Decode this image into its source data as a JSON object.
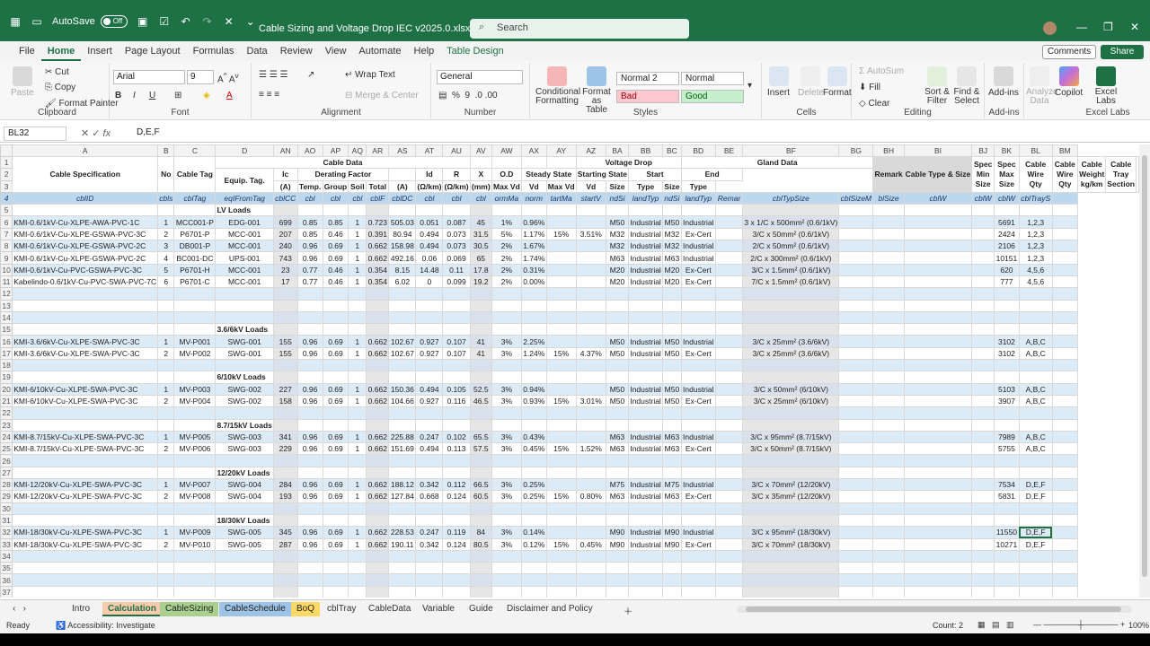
{
  "window": {
    "autosave_label": "AutoSave",
    "autosave_state": "Off",
    "filename": "Cable Sizing and Voltage Drop IEC v2025.0.xlsx",
    "search_placeholder": "Search"
  },
  "tabs": [
    "File",
    "Home",
    "Insert",
    "Page Layout",
    "Formulas",
    "Data",
    "Review",
    "View",
    "Automate",
    "Help",
    "Table Design"
  ],
  "buttons": {
    "comments": "Comments",
    "share": "Share"
  },
  "ribbon": {
    "clipboard": {
      "label": "Clipboard",
      "paste": "Paste",
      "cut": "Cut",
      "copy": "Copy",
      "format_painter": "Format Painter"
    },
    "font": {
      "label": "Font",
      "name": "Arial",
      "size": "9"
    },
    "alignment": {
      "label": "Alignment",
      "wrap": "Wrap Text",
      "merge": "Merge & Center"
    },
    "number": {
      "label": "Number",
      "format": "General"
    },
    "styles": {
      "label": "Styles",
      "conditional": "Conditional Formatting",
      "format_table": "Format as Table",
      "normal2": "Normal 2",
      "normal": "Normal",
      "bad": "Bad",
      "good": "Good"
    },
    "cells": {
      "label": "Cells",
      "insert": "Insert",
      "delete": "Delete",
      "format": "Format"
    },
    "editing": {
      "label": "Editing",
      "autosum": "AutoSum",
      "fill": "Fill",
      "clear": "Clear",
      "sort": "Sort & Filter",
      "find": "Find & Select"
    },
    "addins": {
      "label": "Add-ins",
      "addins": "Add-ins"
    },
    "analyze": {
      "analyze": "Analyze Data"
    },
    "copilot": {
      "copilot": "Copilot"
    },
    "excellabs": {
      "label": "Excel Labs",
      "btn": "Excel Labs"
    }
  },
  "formula": {
    "cell": "BL32",
    "value": "D,E,F"
  },
  "columns": [
    "A",
    "B",
    "C",
    "D",
    "AN",
    "AO",
    "AP",
    "AQ",
    "AR",
    "AS",
    "AT",
    "AU",
    "AV",
    "AW",
    "AX",
    "AY",
    "AZ",
    "BA",
    "BB",
    "BC",
    "BD",
    "BE",
    "BF",
    "BG",
    "BH",
    "BI",
    "BJ",
    "BK",
    "BL",
    "BM"
  ],
  "header": {
    "cable_spec": "Cable Specification",
    "no": "No",
    "cable_tag": "Cable Tag",
    "cable_data": "Cable Data",
    "voltage_drop": "Voltage Drop",
    "gland_data": "Gland Data",
    "remark": "Remark",
    "cable_type_size": "Cable Type & Size",
    "spec_min_size": "Spec Min Size",
    "spec_max_size": "Spec Max Size",
    "cable_wire_qty1": "Cable Wire Qty",
    "cable_wire_qty2": "Cable Wire Qty",
    "cable_weight": "Cable Weight kg/km",
    "cable_tray": "Cable Tray Section",
    "equip_tag": "Equip. Tag.",
    "ic": "Ic",
    "ic_unit": "(A)",
    "derating": "Derating Factor",
    "id": "Id",
    "id_unit": "(A)",
    "r": "R",
    "r_unit": "(Ω/km)",
    "x": "X",
    "x_unit": "(Ω/km)",
    "od": "O.D",
    "od_unit": "(mm)",
    "steady": "Steady State",
    "starting": "Starting State",
    "start": "Start",
    "end": "End",
    "temp": "Temp.",
    "group": "Group",
    "soil": "Soil",
    "total": "Total",
    "max_vd": "Max Vd",
    "vd": "Vd",
    "max_vd2": "Max Vd",
    "vd2": "Vd",
    "size": "Size",
    "type": "Type",
    "size2": "Size",
    "type2": "Type"
  },
  "filter_row": [
    "cblID",
    "cbls",
    "cblTag",
    "eqIFromTag",
    "cblCC",
    "cbl",
    "cbl",
    "cbl",
    "cblF",
    "cblDC",
    "cbl",
    "cbl",
    "cbl",
    "ormMa",
    "norm",
    "tartMa",
    "startV",
    "ndSi",
    "landTyp",
    "ndSi",
    "landTyp",
    "Remar",
    "cblTypSize",
    "cblSizeM",
    "blSize",
    "cblW",
    "cblW",
    "cblW",
    "cblTrayS",
    ""
  ],
  "sections": {
    "lv": "LV Loads",
    "mv36": "3.6/6kV Loads",
    "mv610": "6/10kV Loads",
    "mv87": "8.7/15kV Loads",
    "mv1220": "12/20kV Loads",
    "mv1830": "18/30kV Loads"
  },
  "rows": [
    {
      "r": 6,
      "c": [
        "KMI-0.6/1kV-Cu-XLPE-AWA-PVC-1C",
        "1",
        "MCC001-P",
        "EDG-001",
        "699",
        "0.85",
        "0.85",
        "1",
        "0.723",
        "505.03",
        "0.051",
        "0.087",
        "45",
        "1%",
        "0.96%",
        "",
        "",
        "M50",
        "Industrial",
        "M50",
        "Industrial",
        "",
        "3 x 1/C x 500mm² (0.6/1kV)",
        "",
        "",
        "",
        "",
        "5691",
        "1,2,3",
        ""
      ]
    },
    {
      "r": 7,
      "c": [
        "KMI-0.6/1kV-Cu-XLPE-GSWA-PVC-3C",
        "2",
        "P6701-P",
        "MCC-001",
        "207",
        "0.85",
        "0.46",
        "1",
        "0.391",
        "80.94",
        "0.494",
        "0.073",
        "31.5",
        "5%",
        "1.17%",
        "15%",
        "3.51%",
        "M32",
        "Industrial",
        "M32",
        "Ex-Cert",
        "",
        "3/C x 50mm² (0.6/1kV)",
        "",
        "",
        "",
        "",
        "2424",
        "1,2,3",
        ""
      ]
    },
    {
      "r": 8,
      "c": [
        "KMI-0.6/1kV-Cu-XLPE-GSWA-PVC-2C",
        "3",
        "DB001-P",
        "MCC-001",
        "240",
        "0.96",
        "0.69",
        "1",
        "0.662",
        "158.98",
        "0.494",
        "0.073",
        "30.5",
        "2%",
        "1.67%",
        "",
        "",
        "M32",
        "Industrial",
        "M32",
        "Industrial",
        "",
        "2/C x 50mm² (0.6/1kV)",
        "",
        "",
        "",
        "",
        "2106",
        "1,2,3",
        ""
      ]
    },
    {
      "r": 9,
      "c": [
        "KMI-0.6/1kV-Cu-XLPE-GSWA-PVC-2C",
        "4",
        "BC001-DC",
        "UPS-001",
        "743",
        "0.96",
        "0.69",
        "1",
        "0.662",
        "492.16",
        "0.06",
        "0.069",
        "65",
        "2%",
        "1.74%",
        "",
        "",
        "M63",
        "Industrial",
        "M63",
        "Industrial",
        "",
        "2/C x 300mm² (0.6/1kV)",
        "",
        "",
        "",
        "",
        "10151",
        "1,2,3",
        ""
      ]
    },
    {
      "r": 10,
      "c": [
        "KMI-0.6/1kV-Cu-PVC-GSWA-PVC-3C",
        "5",
        "P6701-H",
        "MCC-001",
        "23",
        "0.77",
        "0.46",
        "1",
        "0.354",
        "8.15",
        "14.48",
        "0.11",
        "17.8",
        "2%",
        "0.31%",
        "",
        "",
        "M20",
        "Industrial",
        "M20",
        "Ex-Cert",
        "",
        "3/C x 1.5mm² (0.6/1kV)",
        "",
        "",
        "",
        "",
        "620",
        "4,5,6",
        ""
      ]
    },
    {
      "r": 11,
      "c": [
        "Kabelindo-0.6/1kV-Cu-PVC-SWA-PVC-7C",
        "6",
        "P6701-C",
        "MCC-001",
        "17",
        "0.77",
        "0.46",
        "1",
        "0.354",
        "6.02",
        "0",
        "0.099",
        "19.2",
        "2%",
        "0.00%",
        "",
        "",
        "M20",
        "Industrial",
        "M20",
        "Ex-Cert",
        "",
        "7/C x 1.5mm² (0.6/1kV)",
        "",
        "",
        "",
        "",
        "777",
        "4,5,6",
        ""
      ]
    },
    {
      "r": 16,
      "c": [
        "KMI-3.6/6kV-Cu-XLPE-SWA-PVC-3C",
        "1",
        "MV-P001",
        "SWG-001",
        "155",
        "0.96",
        "0.69",
        "1",
        "0.662",
        "102.67",
        "0.927",
        "0.107",
        "41",
        "3%",
        "2.25%",
        "",
        "",
        "M50",
        "Industrial",
        "M50",
        "Industrial",
        "",
        "3/C x 25mm² (3.6/6kV)",
        "",
        "",
        "",
        "",
        "3102",
        "A,B,C",
        ""
      ]
    },
    {
      "r": 17,
      "c": [
        "KMI-3.6/6kV-Cu-XLPE-SWA-PVC-3C",
        "2",
        "MV-P002",
        "SWG-001",
        "155",
        "0.96",
        "0.69",
        "1",
        "0.662",
        "102.67",
        "0.927",
        "0.107",
        "41",
        "3%",
        "1.24%",
        "15%",
        "4.37%",
        "M50",
        "Industrial",
        "M50",
        "Ex-Cert",
        "",
        "3/C x 25mm² (3.6/6kV)",
        "",
        "",
        "",
        "",
        "3102",
        "A,B,C",
        ""
      ]
    },
    {
      "r": 20,
      "c": [
        "KMI-6/10kV-Cu-XLPE-SWA-PVC-3C",
        "1",
        "MV-P003",
        "SWG-002",
        "227",
        "0.96",
        "0.69",
        "1",
        "0.662",
        "150.36",
        "0.494",
        "0.105",
        "52.5",
        "3%",
        "0.94%",
        "",
        "",
        "M50",
        "Industrial",
        "M50",
        "Industrial",
        "",
        "3/C x 50mm² (6/10kV)",
        "",
        "",
        "",
        "",
        "5103",
        "A,B,C",
        ""
      ]
    },
    {
      "r": 21,
      "c": [
        "KMI-6/10kV-Cu-XLPE-SWA-PVC-3C",
        "2",
        "MV-P004",
        "SWG-002",
        "158",
        "0.96",
        "0.69",
        "1",
        "0.662",
        "104.66",
        "0.927",
        "0.116",
        "46.5",
        "3%",
        "0.93%",
        "15%",
        "3.01%",
        "M50",
        "Industrial",
        "M50",
        "Ex-Cert",
        "",
        "3/C x 25mm² (6/10kV)",
        "",
        "",
        "",
        "",
        "3907",
        "A,B,C",
        ""
      ]
    },
    {
      "r": 24,
      "c": [
        "KMI-8.7/15kV-Cu-XLPE-SWA-PVC-3C",
        "1",
        "MV-P005",
        "SWG-003",
        "341",
        "0.96",
        "0.69",
        "1",
        "0.662",
        "225.88",
        "0.247",
        "0.102",
        "65.5",
        "3%",
        "0.43%",
        "",
        "",
        "M63",
        "Industrial",
        "M63",
        "Industrial",
        "",
        "3/C x 95mm² (8.7/15kV)",
        "",
        "",
        "",
        "",
        "7989",
        "A,B,C",
        ""
      ]
    },
    {
      "r": 25,
      "c": [
        "KMI-8.7/15kV-Cu-XLPE-SWA-PVC-3C",
        "2",
        "MV-P006",
        "SWG-003",
        "229",
        "0.96",
        "0.69",
        "1",
        "0.662",
        "151.69",
        "0.494",
        "0.113",
        "57.5",
        "3%",
        "0.45%",
        "15%",
        "1.52%",
        "M63",
        "Industrial",
        "M63",
        "Ex-Cert",
        "",
        "3/C x 50mm² (8.7/15kV)",
        "",
        "",
        "",
        "",
        "5755",
        "A,B,C",
        ""
      ]
    },
    {
      "r": 28,
      "c": [
        "KMI-12/20kV-Cu-XLPE-SWA-PVC-3C",
        "1",
        "MV-P007",
        "SWG-004",
        "284",
        "0.96",
        "0.69",
        "1",
        "0.662",
        "188.12",
        "0.342",
        "0.112",
        "66.5",
        "3%",
        "0.25%",
        "",
        "",
        "M75",
        "Industrial",
        "M75",
        "Industrial",
        "",
        "3/C x 70mm² (12/20kV)",
        "",
        "",
        "",
        "",
        "7534",
        "D,E,F",
        ""
      ]
    },
    {
      "r": 29,
      "c": [
        "KMI-12/20kV-Cu-XLPE-SWA-PVC-3C",
        "2",
        "MV-P008",
        "SWG-004",
        "193",
        "0.96",
        "0.69",
        "1",
        "0.662",
        "127.84",
        "0.668",
        "0.124",
        "60.5",
        "3%",
        "0.25%",
        "15%",
        "0.80%",
        "M63",
        "Industrial",
        "M63",
        "Ex-Cert",
        "",
        "3/C x 35mm² (12/20kV)",
        "",
        "",
        "",
        "",
        "5831",
        "D,E,F",
        ""
      ]
    },
    {
      "r": 32,
      "c": [
        "KMI-18/30kV-Cu-XLPE-SWA-PVC-3C",
        "1",
        "MV-P009",
        "SWG-005",
        "345",
        "0.96",
        "0.69",
        "1",
        "0.662",
        "228.53",
        "0.247",
        "0.119",
        "84",
        "3%",
        "0.14%",
        "",
        "",
        "M90",
        "Industrial",
        "M90",
        "Industrial",
        "",
        "3/C x 95mm² (18/30kV)",
        "",
        "",
        "",
        "",
        "11550",
        "D,E,F",
        ""
      ]
    },
    {
      "r": 33,
      "c": [
        "KMI-18/30kV-Cu-XLPE-SWA-PVC-3C",
        "2",
        "MV-P010",
        "SWG-005",
        "287",
        "0.96",
        "0.69",
        "1",
        "0.662",
        "190.11",
        "0.342",
        "0.124",
        "80.5",
        "3%",
        "0.12%",
        "15%",
        "0.45%",
        "M90",
        "Industrial",
        "M90",
        "Ex-Cert",
        "",
        "3/C x 70mm² (18/30kV)",
        "",
        "",
        "",
        "",
        "10271",
        "D,E,F",
        ""
      ]
    }
  ],
  "sheet_tabs": [
    "Intro",
    "Calculation",
    "CableSizing",
    "CableSchedule",
    "BoQ",
    "cblTray",
    "CableData",
    "Variable",
    "Guide",
    "Disclaimer and Policy"
  ],
  "status": {
    "ready": "Ready",
    "accessibility": "Accessibility: Investigate",
    "count": "Count: 2",
    "zoom": "100%"
  }
}
